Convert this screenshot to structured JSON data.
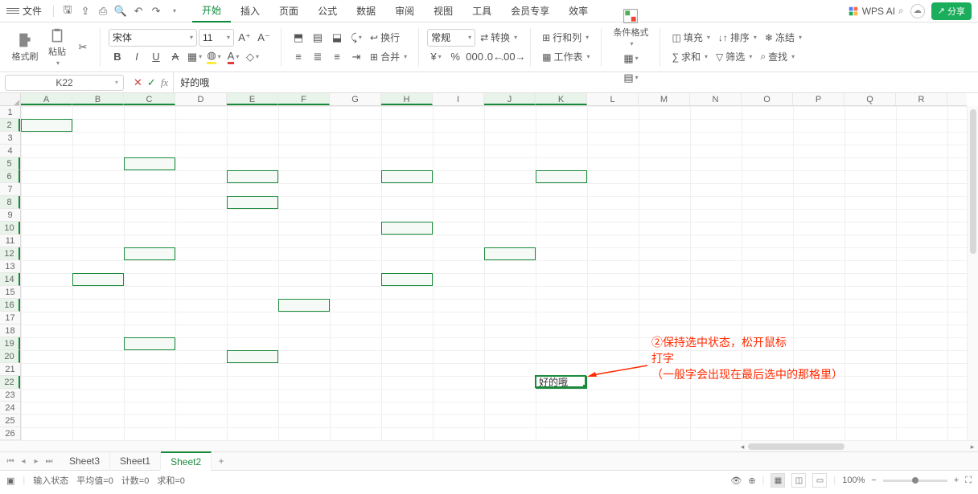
{
  "topbar": {
    "file_label": "文件",
    "tabs": [
      "开始",
      "插入",
      "页面",
      "公式",
      "数据",
      "审阅",
      "视图",
      "工具",
      "会员专享",
      "效率"
    ],
    "active_tab": 0,
    "wps_ai": "WPS AI",
    "share": "分享"
  },
  "ribbon": {
    "format_painter": "格式刷",
    "paste": "粘贴",
    "font_name": "宋体",
    "font_size": "11",
    "wrap": "换行",
    "merge": "合并",
    "general": "常规",
    "convert": "转换",
    "row_col": "行和列",
    "worksheet": "工作表",
    "cond_format": "条件格式",
    "fill": "填充",
    "sum": "求和",
    "sort": "排序",
    "filter": "筛选",
    "freeze": "冻结",
    "find": "查找"
  },
  "formula": {
    "cell_ref": "K22",
    "value": "好的哦"
  },
  "columns": [
    "A",
    "B",
    "C",
    "D",
    "E",
    "F",
    "G",
    "H",
    "I",
    "J",
    "K",
    "L",
    "M",
    "N",
    "O",
    "P",
    "Q",
    "R"
  ],
  "selected_cols": [
    "A",
    "B",
    "C",
    "E",
    "F",
    "H",
    "J",
    "K"
  ],
  "selected_rows": [
    2,
    5,
    6,
    8,
    10,
    12,
    14,
    16,
    19,
    20,
    22
  ],
  "num_rows": 26,
  "cell": {
    "col": "K",
    "row": 22,
    "text": "好的哦"
  },
  "selection_rects": [
    {
      "c": 0,
      "r": 1,
      "w": 1,
      "h": 1
    },
    {
      "c": 2,
      "r": 4,
      "w": 1,
      "h": 1
    },
    {
      "c": 4,
      "r": 5,
      "w": 1,
      "h": 1
    },
    {
      "c": 7,
      "r": 5,
      "w": 1,
      "h": 1
    },
    {
      "c": 10,
      "r": 5,
      "w": 1,
      "h": 1
    },
    {
      "c": 4,
      "r": 7,
      "w": 1,
      "h": 1
    },
    {
      "c": 7,
      "r": 9,
      "w": 1,
      "h": 1
    },
    {
      "c": 2,
      "r": 11,
      "w": 1,
      "h": 1
    },
    {
      "c": 9,
      "r": 11,
      "w": 1,
      "h": 1
    },
    {
      "c": 1,
      "r": 13,
      "w": 1,
      "h": 1
    },
    {
      "c": 7,
      "r": 13,
      "w": 1,
      "h": 1
    },
    {
      "c": 5,
      "r": 15,
      "w": 1,
      "h": 1
    },
    {
      "c": 2,
      "r": 18,
      "w": 1,
      "h": 1
    },
    {
      "c": 4,
      "r": 19,
      "w": 1,
      "h": 1
    },
    {
      "c": 10,
      "r": 21,
      "w": 1,
      "h": 1
    }
  ],
  "annotation": {
    "line1": "②保持选中状态，松开鼠标",
    "line2": "打字",
    "line3": "（一般字会出现在最后选中的那格里）"
  },
  "sheets": {
    "tabs": [
      "Sheet3",
      "Sheet1",
      "Sheet2"
    ],
    "active": 2
  },
  "status": {
    "mode": "输入状态",
    "avg": "平均值=0",
    "count": "计数=0",
    "sum": "求和=0",
    "zoom": "100%"
  }
}
